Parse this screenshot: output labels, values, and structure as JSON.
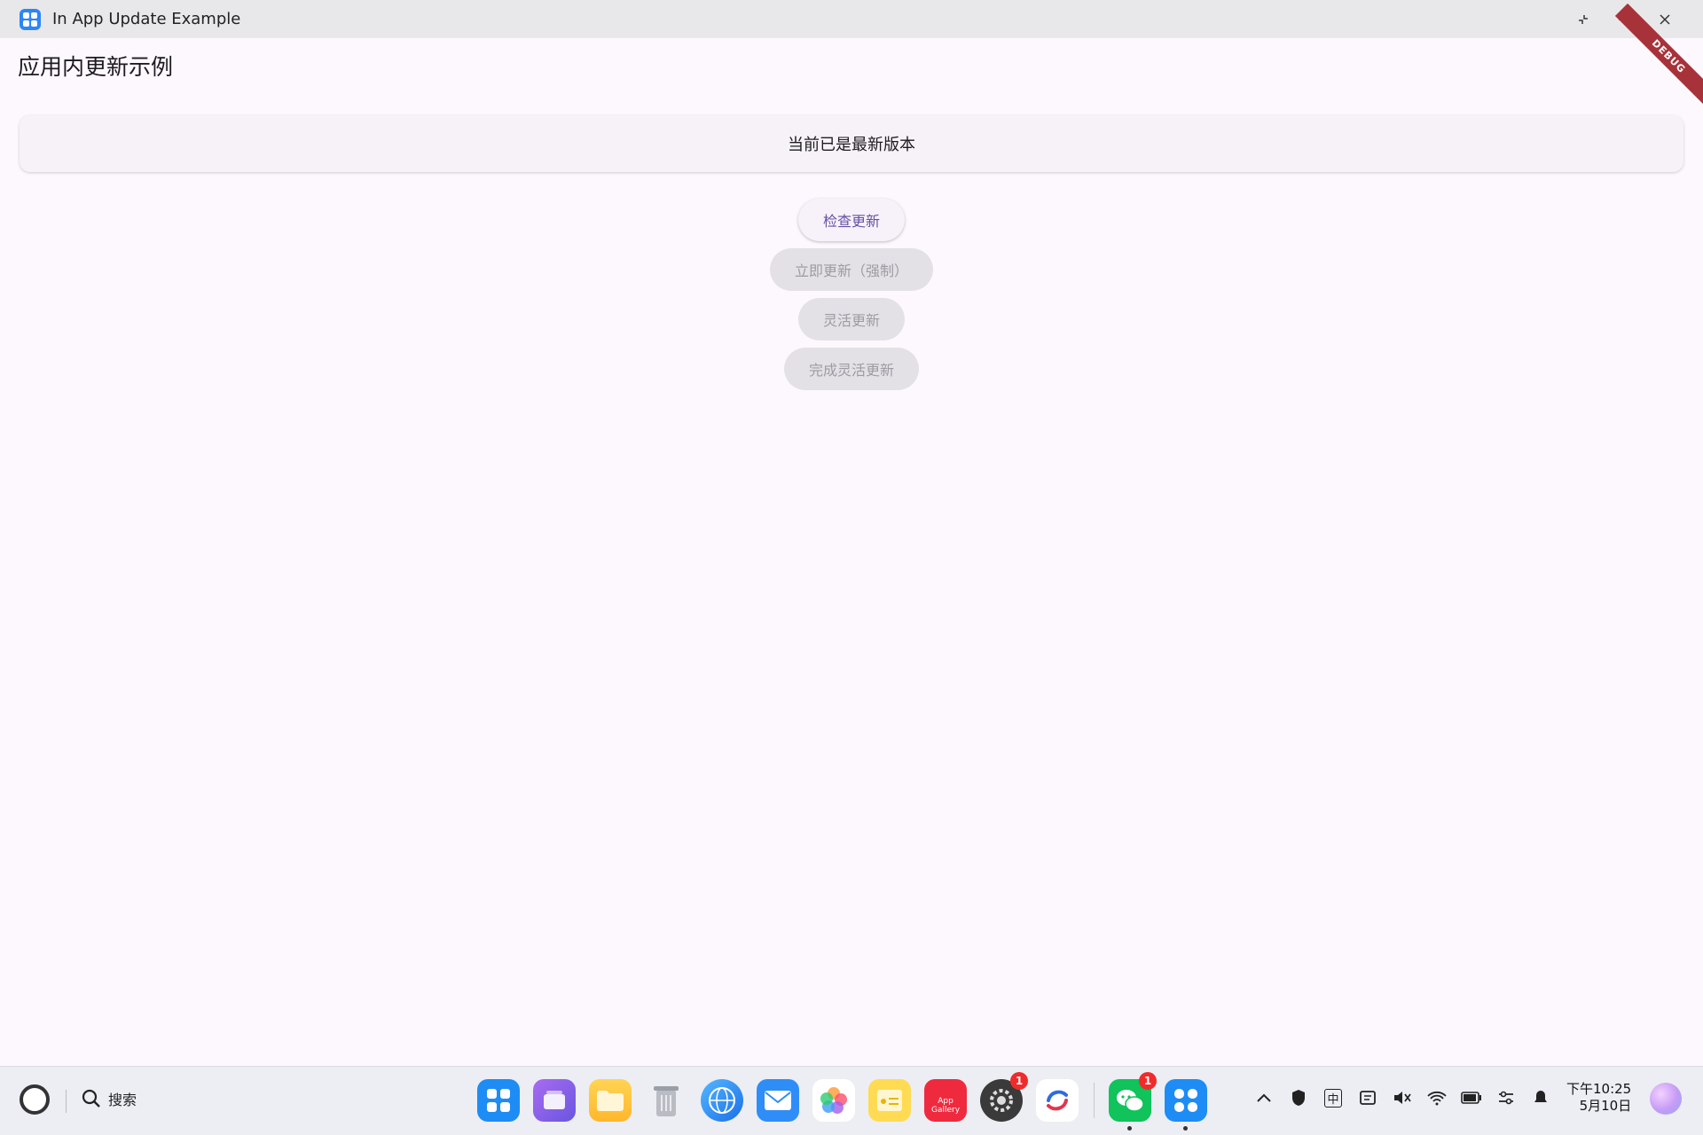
{
  "window": {
    "title": "In App Update Example",
    "controls": {
      "restore": "⤡",
      "minimize": "—",
      "close": "✕"
    },
    "debug_label": "DEBUG"
  },
  "app": {
    "title": "应用内更新示例",
    "status": "当前已是最新版本",
    "buttons": [
      {
        "label": "检查更新",
        "enabled": true
      },
      {
        "label": "立即更新（强制）",
        "enabled": false
      },
      {
        "label": "灵活更新",
        "enabled": false
      },
      {
        "label": "完成灵活更新",
        "enabled": false
      }
    ]
  },
  "taskbar": {
    "search_label": "搜索",
    "dock": [
      {
        "name": "launcher-icon"
      },
      {
        "name": "multi-window-icon"
      },
      {
        "name": "files-icon"
      },
      {
        "name": "trash-icon"
      },
      {
        "name": "browser-icon"
      },
      {
        "name": "mail-icon"
      },
      {
        "name": "photos-icon"
      },
      {
        "name": "notes-icon"
      },
      {
        "name": "app-gallery-icon",
        "label_line1": "App",
        "label_line2": "Gallery"
      },
      {
        "name": "settings-icon",
        "badge": "1"
      },
      {
        "name": "code-icon"
      },
      {
        "name": "wechat-icon",
        "badge": "1"
      },
      {
        "name": "in-app-update-icon"
      }
    ],
    "tray": {
      "ime": "中",
      "clock_time": "下午10:25",
      "clock_date": "5月10日"
    }
  }
}
